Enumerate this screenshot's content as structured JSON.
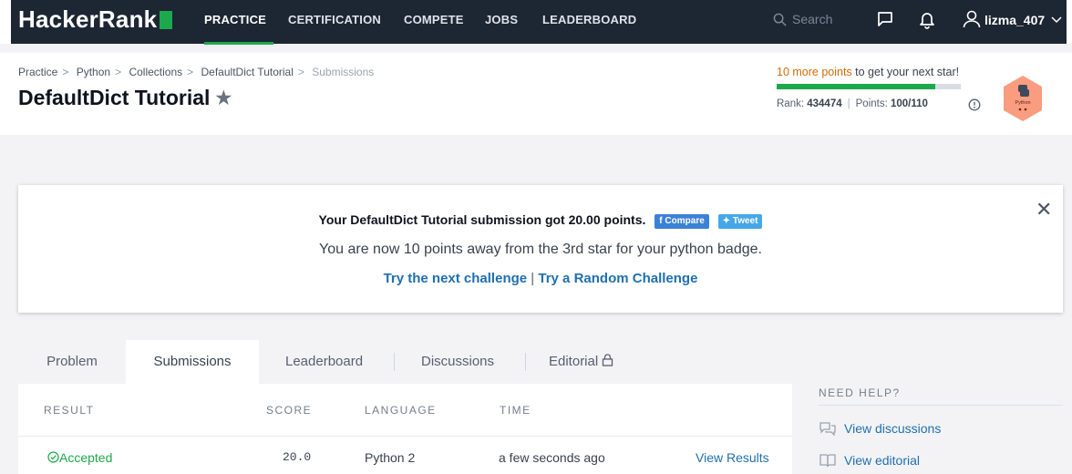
{
  "nav": {
    "logo": "HackerRank",
    "items": [
      "PRACTICE",
      "CERTIFICATION",
      "COMPETE",
      "JOBS",
      "LEADERBOARD"
    ],
    "active": "PRACTICE",
    "search_placeholder": "Search",
    "username": "lizma_407"
  },
  "header": {
    "breadcrumb": [
      "Practice",
      "Python",
      "Collections",
      "DefaultDict Tutorial",
      "Submissions"
    ],
    "title": "DefaultDict Tutorial",
    "stars_highlight": "10 more points",
    "stars_rest": " to get your next star!",
    "progress": 0.862,
    "rank_label": "Rank:",
    "rank_value": "434474",
    "points_label": "Points:",
    "points_value": "100/110",
    "badge_label": "Python"
  },
  "notice": {
    "headline": "Your DefaultDict Tutorial submission got 20.00 points.",
    "share_fb": "Compare",
    "share_tw": "Tweet",
    "subline": "You are now 10 points away from the 3rd star for your python badge.",
    "next_link": "Try the next challenge",
    "divider": "|",
    "random_link": "Try a Random Challenge"
  },
  "tabs": [
    "Problem",
    "Submissions",
    "Leaderboard",
    "Discussions",
    "Editorial"
  ],
  "active_tab": "Submissions",
  "table": {
    "headers": [
      "RESULT",
      "SCORE",
      "LANGUAGE",
      "TIME"
    ],
    "rows": [
      {
        "result": "Accepted",
        "score": "20.0",
        "language": "Python 2",
        "time": "a few seconds ago",
        "action": "View Results"
      }
    ]
  },
  "help": {
    "title": "NEED HELP?",
    "links": [
      "View discussions",
      "View editorial"
    ]
  },
  "colors": {
    "nav_bg": "#1d2633",
    "accent_green": "#1ba94c",
    "link_blue": "#1f6fb1",
    "star_orange": "#d46b08"
  }
}
